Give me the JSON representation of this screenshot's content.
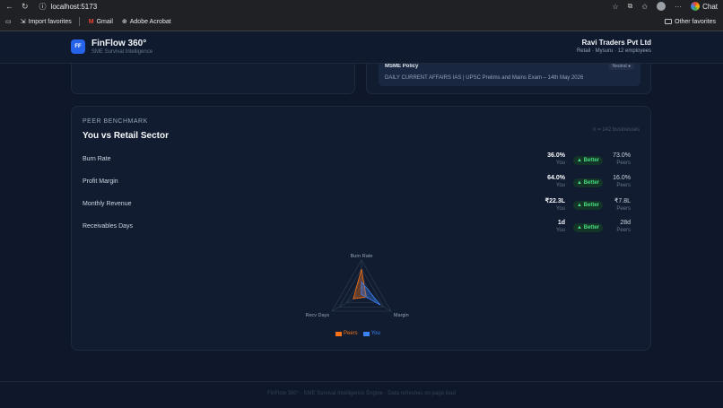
{
  "browser": {
    "url": "localhost:5173",
    "chat_label": "Chat",
    "favorites": [
      "Import favorites",
      "Gmail",
      "Adobe Acrobat"
    ],
    "other_favorites": "Other favorites"
  },
  "header": {
    "logo": "FF",
    "title": "FinFlow 360°",
    "subtitle": "SME Survival Intelligence",
    "company_name": "Ravi Traders Pvt Ltd",
    "company_meta": "Retail · Mysuru · 12 employees"
  },
  "news": {
    "title": "MSME Policy",
    "badge": "Neutral ●",
    "text": "DAILY CURRENT AFFAIRS IAS | UPSC Prelims and Mains Exam – 14th May 2026"
  },
  "benchmark": {
    "eyebrow": "PEER BENCHMARK",
    "title": "You vs Retail Sector",
    "count": "n = 142 businesses",
    "you_label": "You",
    "peers_label": "Peers",
    "metrics": [
      {
        "label": "Burn Rate",
        "you": "36.0%",
        "status": "▲ Better",
        "peers": "73.0%"
      },
      {
        "label": "Profit Margin",
        "you": "64.0%",
        "status": "▲ Better",
        "peers": "16.0%"
      },
      {
        "label": "Monthly Revenue",
        "you": "₹22.3L",
        "status": "▲ Better",
        "peers": "₹7.8L"
      },
      {
        "label": "Receivables Days",
        "you": "1d",
        "status": "▲ Better",
        "peers": "28d"
      }
    ]
  },
  "radar": {
    "axes": [
      "Burn Rate",
      "Margin",
      "Recv Days"
    ],
    "legend": [
      "Peers",
      "You"
    ],
    "colors": {
      "peers": "#f97316",
      "you": "#3b82f6"
    },
    "scores": {
      "peers": [
        0.73,
        0.16,
        0.28
      ],
      "you": [
        0.36,
        0.64,
        0.01
      ]
    }
  },
  "footer": "FinFlow 360° · SME Survival Intelligence Engine · Data refreshes on page load"
}
